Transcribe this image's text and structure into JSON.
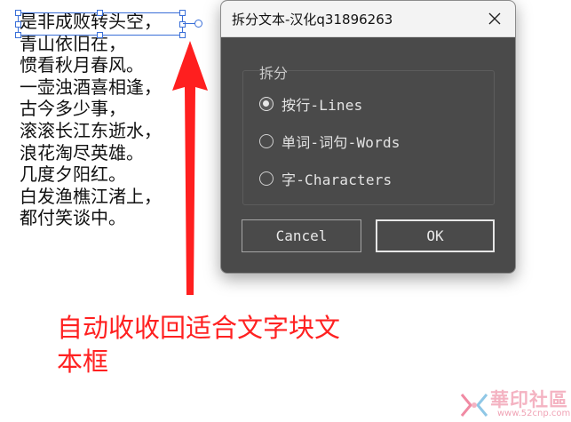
{
  "canvas": {
    "poem_lines": [
      "是非成败转头空，",
      "青山依旧在，",
      "惯看秋月春风。",
      "一壶浊酒喜相逢，",
      "古今多少事，",
      "滚滚长江东逝水，",
      "浪花淘尽英雄。",
      "几度夕阳红。",
      "白发渔樵江渚上，",
      "都付笑谈中。"
    ],
    "annotation": "自动收收回适合文字块文本框",
    "colors": {
      "annotation": "#ff2121",
      "selection": "#3a6fd8"
    }
  },
  "dialog": {
    "title": "拆分文本-汉化q31896263",
    "group_label": "拆分",
    "options": [
      {
        "label": "按行-Lines",
        "checked": true
      },
      {
        "label": "单词-词句-Words",
        "checked": false
      },
      {
        "label": "字-Characters",
        "checked": false
      }
    ],
    "cancel_label": "Cancel",
    "ok_label": "OK",
    "close_icon": "close-icon",
    "colors": {
      "background": "#4a4a4a",
      "titlebar": "#f3f3f3"
    }
  },
  "watermark": {
    "text": "華印社區",
    "url": "www.52cnp.com"
  }
}
